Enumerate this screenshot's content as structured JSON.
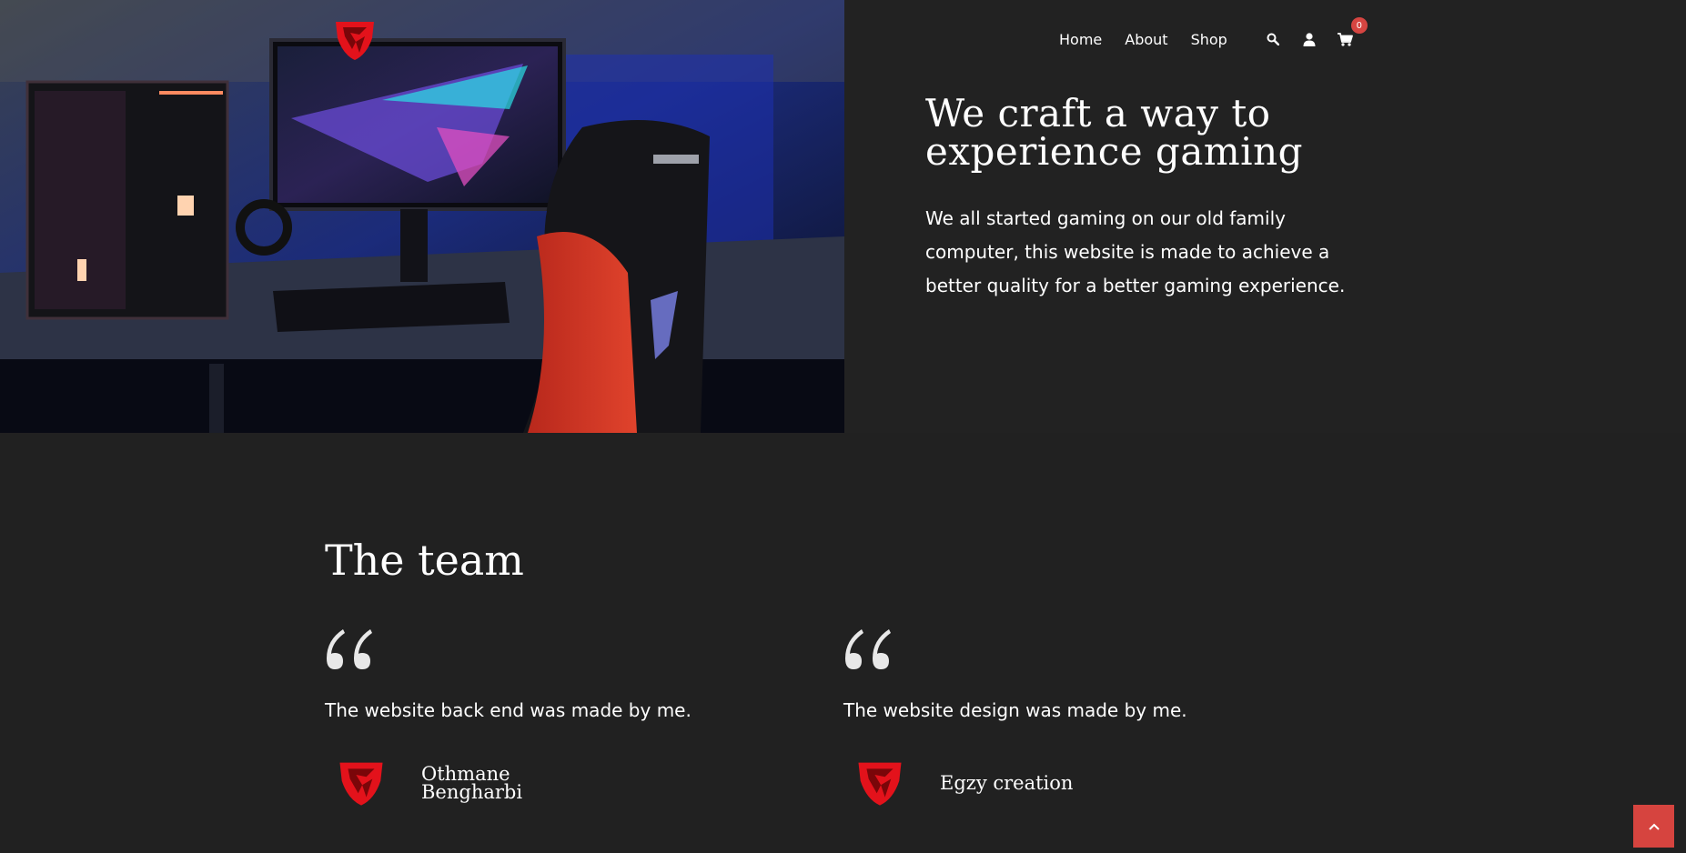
{
  "nav": {
    "links": [
      "Home",
      "About",
      "Shop"
    ],
    "cart_count": "0"
  },
  "hero": {
    "title": "We craft a way to experience gaming",
    "text": "We all started gaming on our old family computer, this website is made to achieve a better quality for a better gaming experience.",
    "image_alt": "Gaming setup with PC, monitor and gaming chair"
  },
  "team": {
    "title": "The team",
    "members": [
      {
        "quote": "The website back end was made by me.",
        "name": "Othmane Bengharbi"
      },
      {
        "quote": "The website design was made by me.",
        "name": "Egzy creation"
      }
    ]
  },
  "colors": {
    "background": "#212121",
    "accent": "#d6443f",
    "logo_red": "#e3121b"
  },
  "icons": [
    "logo-icon",
    "search-icon",
    "user-icon",
    "cart-icon",
    "quote-icon",
    "chevron-up-icon"
  ]
}
